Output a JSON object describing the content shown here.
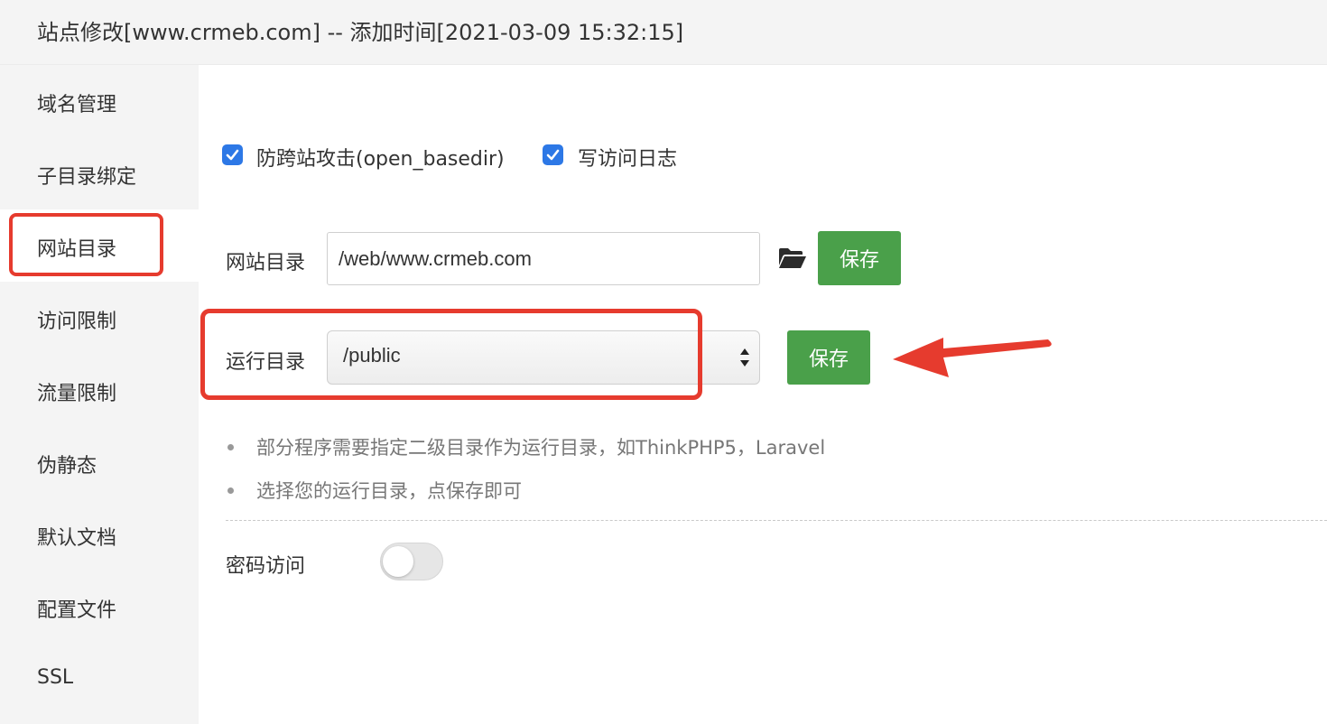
{
  "window": {
    "title": "站点修改[www.crmeb.com] -- 添加时间[2021-03-09 15:32:15]"
  },
  "sidebar": {
    "items": [
      {
        "label": "域名管理"
      },
      {
        "label": "子目录绑定"
      },
      {
        "label": "网站目录",
        "active": true
      },
      {
        "label": "访问限制"
      },
      {
        "label": "流量限制"
      },
      {
        "label": "伪静态"
      },
      {
        "label": "默认文档"
      },
      {
        "label": "配置文件"
      },
      {
        "label": "SSL"
      }
    ]
  },
  "options": {
    "open_basedir_label": "防跨站攻击(open_basedir)",
    "open_basedir_checked": true,
    "access_log_label": "写访问日志",
    "access_log_checked": true
  },
  "site_dir": {
    "label": "网站目录",
    "value": "/web/www.crmeb.com",
    "save_label": "保存"
  },
  "run_dir": {
    "label": "运行目录",
    "selected": "/public",
    "save_label": "保存"
  },
  "tips": [
    "部分程序需要指定二级目录作为运行目录，如ThinkPHP5，Laravel",
    "选择您的运行目录，点保存即可"
  ],
  "password_access": {
    "label": "密码访问",
    "enabled": false
  },
  "colors": {
    "accent_blue": "#2d78e6",
    "button_green": "#4aa04a",
    "annotation_red": "#e63b2e"
  },
  "icons": {
    "folder": "folder-open-icon",
    "checkbox": "checkmark-icon",
    "select_arrows": "updown-arrows-icon"
  }
}
